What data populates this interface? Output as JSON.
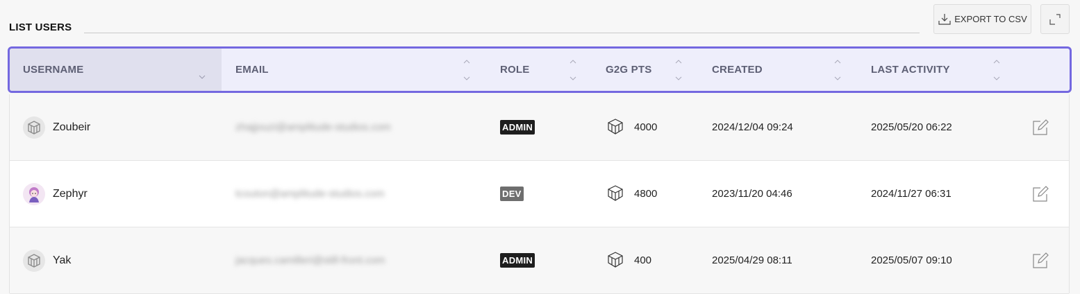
{
  "page": {
    "title": "LIST USERS",
    "export_label": "EXPORT TO CSV",
    "export_icon": "download-icon",
    "expand_icon": "expand-icon"
  },
  "colors": {
    "header_border": "#7468e0",
    "header_bg": "#eeeefb",
    "sorted_column_bg": "#e0e0ee",
    "admin_badge": "#1e1e1e",
    "dev_badge": "#6e6e6e"
  },
  "table": {
    "columns": [
      {
        "key": "username",
        "label": "USERNAME",
        "sorted": "desc"
      },
      {
        "key": "email",
        "label": "EMAIL"
      },
      {
        "key": "role",
        "label": "ROLE"
      },
      {
        "key": "g2g_pts",
        "label": "G2G PTS"
      },
      {
        "key": "created",
        "label": "CREATED"
      },
      {
        "key": "last_activity",
        "label": "LAST ACTIVITY"
      }
    ],
    "rows": [
      {
        "username": "Zoubeir",
        "avatar": "cube-avatar-icon",
        "email": "zhajjouzi@amplitude-studios.com",
        "role": "ADMIN",
        "g2g_pts": "4000",
        "created": "2024/12/04 09:24",
        "last_activity": "2025/05/20 06:22"
      },
      {
        "username": "Zephyr",
        "avatar": "character-avatar-icon",
        "email": "tcouton@amplitude-studios.com",
        "role": "DEV",
        "g2g_pts": "4800",
        "created": "2023/11/20 04:46",
        "last_activity": "2024/11/27 06:31"
      },
      {
        "username": "Yak",
        "avatar": "cube-avatar-icon",
        "email": "jacques.camilleri@still-front.com",
        "role": "ADMIN",
        "g2g_pts": "400",
        "created": "2025/04/29 08:11",
        "last_activity": "2025/05/07 09:10"
      }
    ]
  }
}
